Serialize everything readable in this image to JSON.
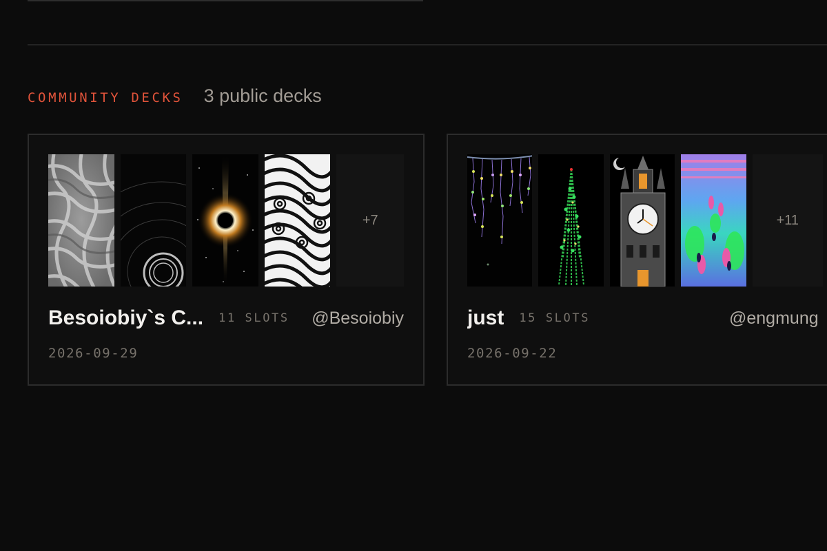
{
  "section": {
    "title": "COMMUNITY DECKS",
    "count": "3 public decks"
  },
  "decks": [
    {
      "name": "Besoiobiy`s C...",
      "slots": "11 SLOTS",
      "owner": "@Besoiobiy",
      "date": "2026-09-29",
      "more": "+7",
      "thumbnails": [
        "woven-lattice-thumbnail",
        "ring-ripples-thumbnail",
        "black-hole-thumbnail",
        "moire-spirals-thumbnail"
      ]
    },
    {
      "name": "just",
      "slots": "15 SLOTS",
      "owner": "@engmung",
      "date": "2026-09-22",
      "more": "+11",
      "thumbnails": [
        "string-lights-thumbnail",
        "christmas-tree-thumbnail",
        "clock-tower-thumbnail",
        "neon-waves-thumbnail"
      ]
    }
  ],
  "colors": {
    "accent": "#e0533a",
    "background": "#0c0c0c",
    "card_border": "#2c2c2c"
  }
}
